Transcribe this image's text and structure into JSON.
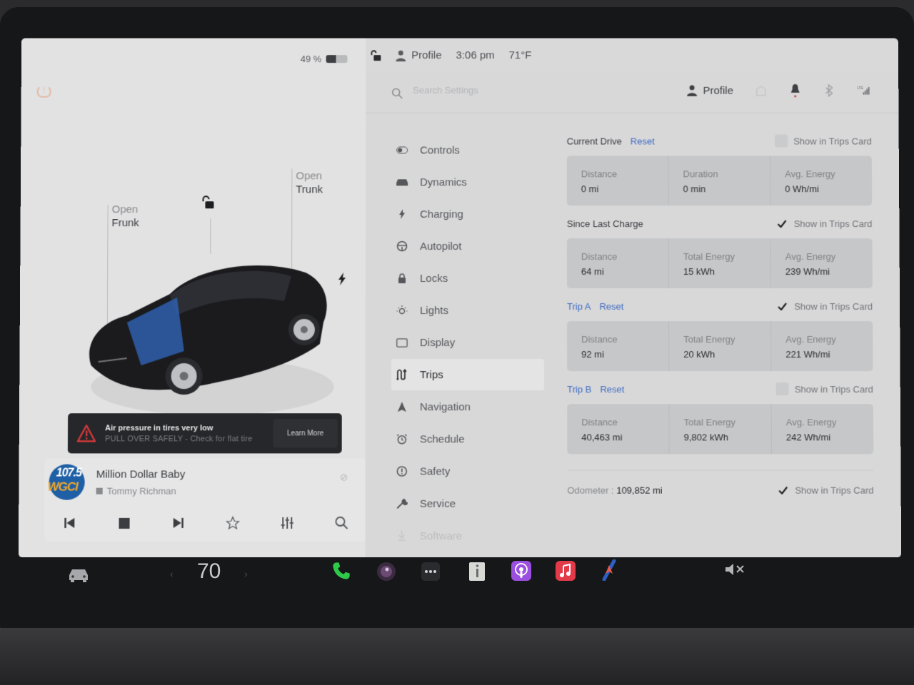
{
  "status_bar": {
    "battery_percent_label": "49 %",
    "battery_level": 0.49,
    "profile_label": "Profile",
    "time": "3:06 pm",
    "outside_temp": "71°F"
  },
  "car_panel": {
    "frunk": {
      "action": "Open",
      "label": "Frunk"
    },
    "trunk": {
      "action": "Open",
      "label": "Trunk"
    },
    "lock_state": "unlocked",
    "alert": {
      "title": "Air pressure in tires very low",
      "subtitle": "PULL OVER SAFELY - Check for flat tire",
      "button": "Learn More"
    }
  },
  "media": {
    "station_logo_top": "107.5",
    "station_logo_bottom": "WGCI",
    "song": "Million Dollar Baby",
    "artist": "Tommy Richman",
    "controls": [
      "previous",
      "stop",
      "next",
      "favorite",
      "equalizer",
      "search"
    ]
  },
  "settings": {
    "search_placeholder": "Search Settings",
    "profile_label": "Profile",
    "menu": [
      {
        "label": "Controls",
        "icon": "toggle-icon",
        "state": "normal"
      },
      {
        "label": "Dynamics",
        "icon": "car-icon",
        "state": "normal"
      },
      {
        "label": "Charging",
        "icon": "bolt-icon",
        "state": "normal"
      },
      {
        "label": "Autopilot",
        "icon": "steering-wheel-icon",
        "state": "normal"
      },
      {
        "label": "Locks",
        "icon": "lock-icon",
        "state": "normal"
      },
      {
        "label": "Lights",
        "icon": "light-icon",
        "state": "normal"
      },
      {
        "label": "Display",
        "icon": "display-icon",
        "state": "normal"
      },
      {
        "label": "Trips",
        "icon": "trips-icon",
        "state": "active"
      },
      {
        "label": "Navigation",
        "icon": "navigation-icon",
        "state": "normal"
      },
      {
        "label": "Schedule",
        "icon": "schedule-icon",
        "state": "normal"
      },
      {
        "label": "Safety",
        "icon": "safety-icon",
        "state": "normal"
      },
      {
        "label": "Service",
        "icon": "wrench-icon",
        "state": "normal"
      },
      {
        "label": "Software",
        "icon": "download-icon",
        "state": "faded"
      }
    ],
    "trips": {
      "show_card_label": "Show in Trips Card",
      "reset_label": "Reset",
      "sections": [
        {
          "title": "Current Drive",
          "has_reset": true,
          "title_blue": false,
          "show_in_card": false,
          "stats": [
            {
              "label": "Distance",
              "value": "0 mi"
            },
            {
              "label": "Duration",
              "value": "0 min"
            },
            {
              "label": "Avg. Energy",
              "value": "0 Wh/mi"
            }
          ]
        },
        {
          "title": "Since Last Charge",
          "has_reset": false,
          "title_blue": false,
          "show_in_card": true,
          "stats": [
            {
              "label": "Distance",
              "value": "64 mi"
            },
            {
              "label": "Total Energy",
              "value": "15 kWh"
            },
            {
              "label": "Avg. Energy",
              "value": "239 Wh/mi"
            }
          ]
        },
        {
          "title": "Trip A",
          "has_reset": true,
          "title_blue": true,
          "show_in_card": true,
          "stats": [
            {
              "label": "Distance",
              "value": "92 mi"
            },
            {
              "label": "Total Energy",
              "value": "20 kWh"
            },
            {
              "label": "Avg. Energy",
              "value": "221 Wh/mi"
            }
          ]
        },
        {
          "title": "Trip B",
          "has_reset": true,
          "title_blue": true,
          "show_in_card": false,
          "stats": [
            {
              "label": "Distance",
              "value": "40,463 mi"
            },
            {
              "label": "Total Energy",
              "value": "9,802 kWh"
            },
            {
              "label": "Avg. Energy",
              "value": "242 Wh/mi"
            }
          ]
        }
      ],
      "odometer": {
        "label": "Odometer :",
        "value": "109,852 mi",
        "show_in_card": true
      }
    }
  },
  "dock": {
    "cabin_temp": "70",
    "apps": [
      "phone",
      "camera",
      "more",
      "manual",
      "podcasts",
      "music",
      "navigation-app"
    ],
    "volume_state": "muted"
  },
  "colors": {
    "accent_blue": "#3f6cc2",
    "alert_red": "#d0383a",
    "phone_green": "#2ec84a",
    "podcasts_purple": "#9b4fe0",
    "music_red": "#e23a48"
  }
}
